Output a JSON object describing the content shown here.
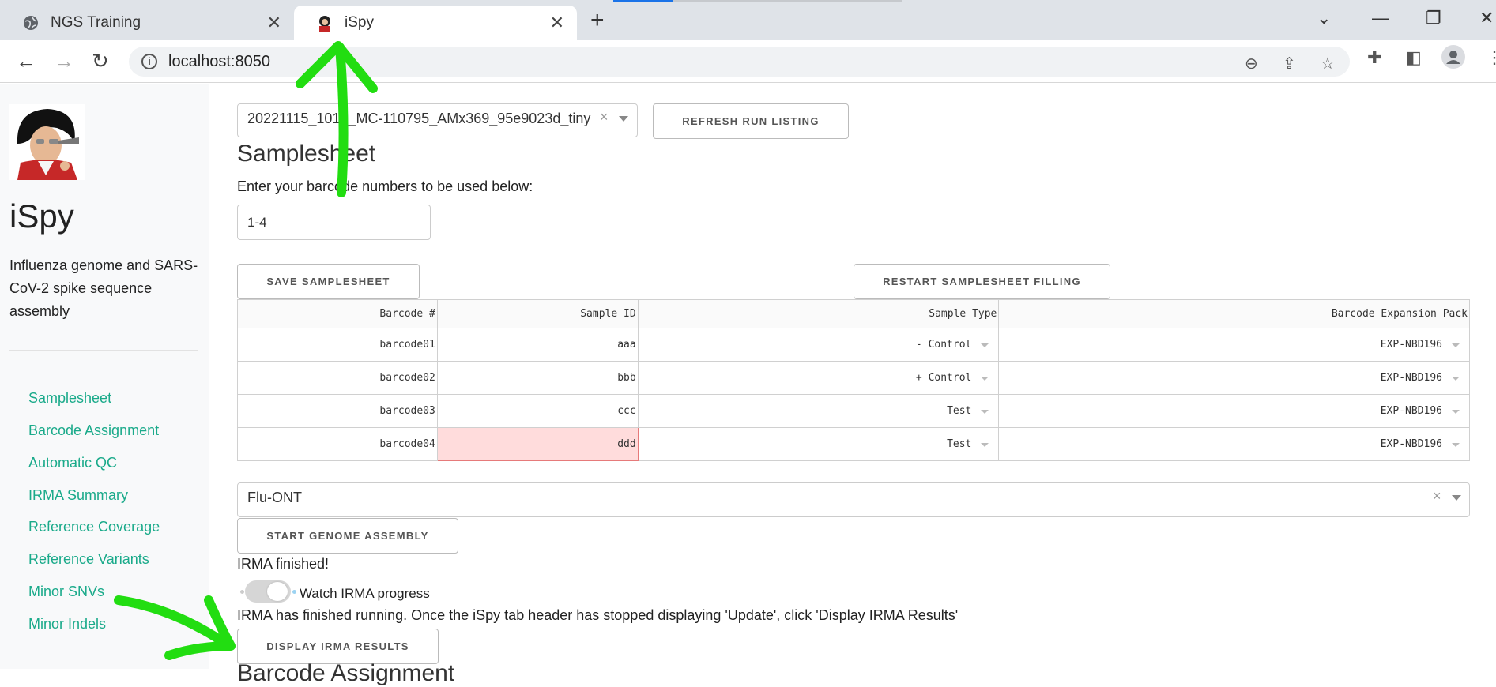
{
  "browser": {
    "tabs": [
      {
        "title": "NGS Training",
        "icon": "globe-icon",
        "active": false
      },
      {
        "title": "iSpy",
        "icon": "ispy-favicon",
        "active": true
      }
    ],
    "url": "localhost:8050"
  },
  "sidebar": {
    "title": "iSpy",
    "description": "Influenza genome and SARS-CoV-2 spike sequence assembly",
    "nav": [
      {
        "label": "Samplesheet"
      },
      {
        "label": "Barcode Assignment"
      },
      {
        "label": "Automatic QC"
      },
      {
        "label": "IRMA Summary"
      },
      {
        "label": "Reference Coverage"
      },
      {
        "label": "Reference Variants"
      },
      {
        "label": "Minor SNVs"
      },
      {
        "label": "Minor Indels"
      }
    ],
    "link_color": "#1aaa8a"
  },
  "main": {
    "run_select": {
      "value": "20221115_1016_MC-110795_AMx369_95e9023d_tiny"
    },
    "refresh_button": "REFRESH RUN LISTING",
    "samplesheet_heading": "Samplesheet",
    "barcode_prompt": "Enter your barcode numbers to be used below:",
    "barcode_input": "1-4",
    "save_button": "SAVE SAMPLESHEET",
    "restart_button": "RESTART SAMPLESHEET FILLING",
    "table": {
      "columns": [
        "Barcode #",
        "Sample ID",
        "Sample Type",
        "Barcode Expansion Pack"
      ],
      "rows": [
        {
          "barcode": "barcode01",
          "sample_id": "aaa",
          "sample_type": "- Control",
          "expansion": "EXP-NBD196"
        },
        {
          "barcode": "barcode02",
          "sample_id": "bbb",
          "sample_type": "+ Control",
          "expansion": "EXP-NBD196"
        },
        {
          "barcode": "barcode03",
          "sample_id": "ccc",
          "sample_type": "Test",
          "expansion": "EXP-NBD196"
        },
        {
          "barcode": "barcode04",
          "sample_id": "ddd",
          "sample_type": "Test",
          "expansion": "EXP-NBD196"
        }
      ]
    },
    "module_select": {
      "value": "Flu-ONT"
    },
    "start_button": "START GENOME ASSEMBLY",
    "irma_status": "IRMA finished!",
    "watch_toggle": {
      "label": "Watch IRMA progress",
      "on": true
    },
    "irma_message": "IRMA has finished running. Once the iSpy tab header has stopped displaying 'Update', click 'Display IRMA Results'",
    "display_button": "DISPLAY IRMA RESULTS",
    "next_heading": "Barcode Assignment"
  },
  "annotations": {
    "arrow_color": "#22dd11"
  }
}
